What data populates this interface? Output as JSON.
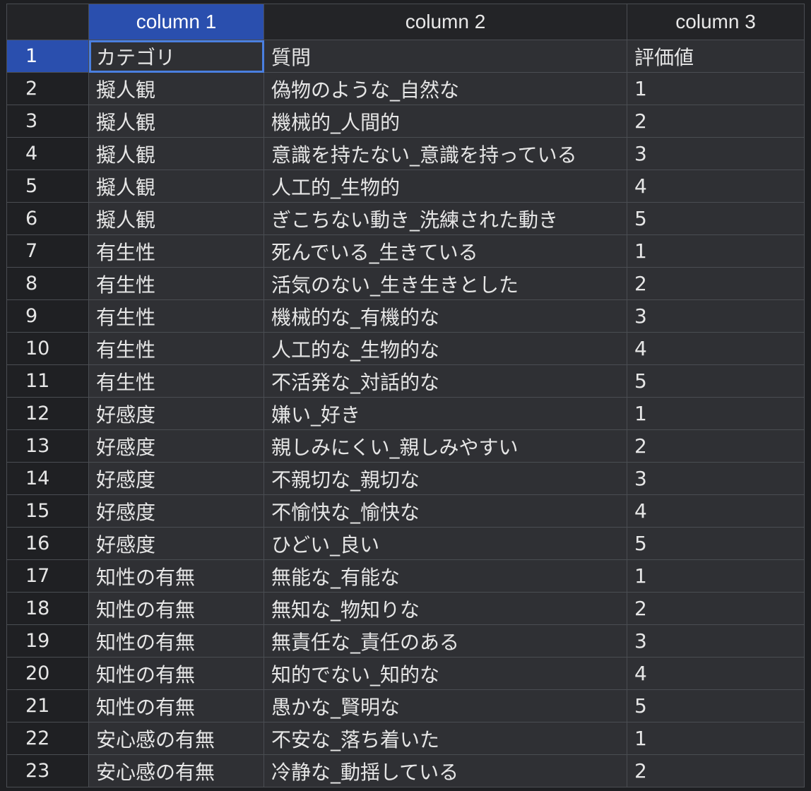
{
  "columns": [
    "column 1",
    "column 2",
    "column 3"
  ],
  "rows": [
    {
      "n": "1",
      "c1": "カテゴリ",
      "c2": "質問",
      "c3": "評価値"
    },
    {
      "n": "2",
      "c1": "擬人観",
      "c2": "偽物のような_自然な",
      "c3": "1"
    },
    {
      "n": "3",
      "c1": "擬人観",
      "c2": "機械的_人間的",
      "c3": "2"
    },
    {
      "n": "4",
      "c1": "擬人観",
      "c2": "意識を持たない_意識を持っている",
      "c3": "3"
    },
    {
      "n": "5",
      "c1": "擬人観",
      "c2": "人工的_生物的",
      "c3": "4"
    },
    {
      "n": "6",
      "c1": "擬人観",
      "c2": "ぎこちない動き_洗練された動き",
      "c3": "5"
    },
    {
      "n": "7",
      "c1": "有生性",
      "c2": "死んでいる_生きている",
      "c3": "1"
    },
    {
      "n": "8",
      "c1": "有生性",
      "c2": "活気のない_生き生きとした",
      "c3": "2"
    },
    {
      "n": "9",
      "c1": "有生性",
      "c2": "機械的な_有機的な",
      "c3": "3"
    },
    {
      "n": "10",
      "c1": "有生性",
      "c2": "人工的な_生物的な",
      "c3": "4"
    },
    {
      "n": "11",
      "c1": "有生性",
      "c2": "不活発な_対話的な",
      "c3": "5"
    },
    {
      "n": "12",
      "c1": "好感度",
      "c2": "嫌い_好き",
      "c3": "1"
    },
    {
      "n": "13",
      "c1": "好感度",
      "c2": "親しみにくい_親しみやすい",
      "c3": "2"
    },
    {
      "n": "14",
      "c1": "好感度",
      "c2": "不親切な_親切な",
      "c3": "3"
    },
    {
      "n": "15",
      "c1": "好感度",
      "c2": "不愉快な_愉快な",
      "c3": "4"
    },
    {
      "n": "16",
      "c1": "好感度",
      "c2": "ひどい_良い",
      "c3": "5"
    },
    {
      "n": "17",
      "c1": "知性の有無",
      "c2": "無能な_有能な",
      "c3": "1"
    },
    {
      "n": "18",
      "c1": "知性の有無",
      "c2": "無知な_物知りな",
      "c3": "2"
    },
    {
      "n": "19",
      "c1": "知性の有無",
      "c2": "無責任な_責任のある",
      "c3": "3"
    },
    {
      "n": "20",
      "c1": "知性の有無",
      "c2": "知的でない_知的な",
      "c3": "4"
    },
    {
      "n": "21",
      "c1": "知性の有無",
      "c2": "愚かな_賢明な",
      "c3": "5"
    },
    {
      "n": "22",
      "c1": "安心感の有無",
      "c2": "不安な_落ち着いた",
      "c3": "1"
    },
    {
      "n": "23",
      "c1": "安心感の有無",
      "c2": "冷静な_動揺している",
      "c3": "2"
    }
  ],
  "selection": {
    "row": 0,
    "column": 0
  },
  "colors": {
    "selected": "#2a4fae",
    "cell_bg": "#2f3034",
    "border": "#4a4d52"
  }
}
